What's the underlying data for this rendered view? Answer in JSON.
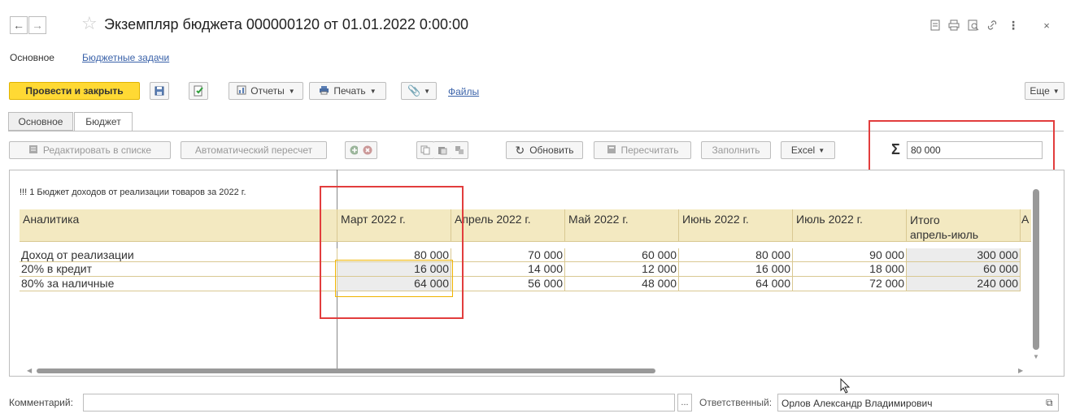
{
  "window": {
    "title": "Экземпляр бюджета 000000120 от 01.01.2022 0:00:00",
    "icons": [
      "back-arrow-icon",
      "forward-arrow-icon",
      "star-icon",
      "save-doc-icon",
      "print-icon",
      "preview-icon",
      "link-icon",
      "more-icon",
      "close-icon"
    ]
  },
  "nav": {
    "main": "Основное",
    "budget_tasks": "Бюджетные задачи"
  },
  "toolbar": {
    "post_close": "Провести и закрыть",
    "reports": "Отчеты",
    "print": "Печать",
    "files": "Файлы",
    "more": "Еще"
  },
  "tabs": {
    "main": "Основное",
    "budget": "Бюджет"
  },
  "report_toolbar": {
    "edit_list": "Редактировать в списке",
    "auto_recalc": "Автоматический пересчет",
    "refresh": "Обновить",
    "recalc": "Пересчитать",
    "fill": "Заполнить",
    "excel": "Excel",
    "sum_value": "80 000"
  },
  "report": {
    "title": "!!! 1 Бюджет доходов от реализации товаров за 2022 г.",
    "headers": [
      "Аналитика",
      "Март 2022 г.",
      "Апрель 2022 г.",
      "Май 2022 г.",
      "Июнь 2022 г.",
      "Июль 2022 г.",
      "Итого",
      "апрель-июль",
      "А"
    ],
    "rows": [
      {
        "label": "Доход от реализации",
        "values": [
          "80 000",
          "70 000",
          "60 000",
          "80 000",
          "90 000",
          "300 000"
        ]
      },
      {
        "label": "20% в кредит",
        "values": [
          "16 000",
          "14 000",
          "12 000",
          "16 000",
          "18 000",
          "60 000"
        ]
      },
      {
        "label": "80% за наличные",
        "values": [
          "64 000",
          "56 000",
          "48 000",
          "64 000",
          "72 000",
          "240 000"
        ]
      }
    ]
  },
  "bottom": {
    "comment_label": "Комментарий:",
    "comment_value": "",
    "dots": "...",
    "responsible_label": "Ответственный:",
    "responsible_value": "Орлов Александр Владимирович"
  }
}
